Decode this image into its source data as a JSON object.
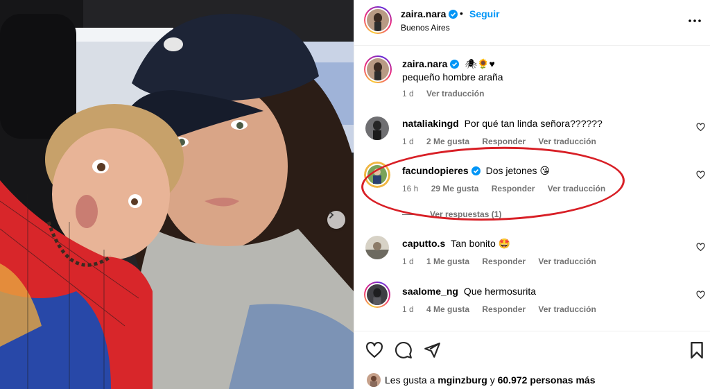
{
  "post": {
    "username": "zaira.nara",
    "separator": "•",
    "follow_label": "Seguir",
    "location": "Buenos Aires"
  },
  "caption": {
    "username": "zaira.nara",
    "emojis": "🕷🌻♥",
    "text": "pequeño hombre araña",
    "time": "1 d",
    "translate": "Ver traducción"
  },
  "comments": [
    {
      "username": "nataliakingd",
      "text": "Por qué tan linda señora??????",
      "time": "1 d",
      "likes": "2 Me gusta",
      "reply": "Responder",
      "translate": "Ver traducción"
    },
    {
      "username": "facundopieres",
      "verified": true,
      "text": "Dos jetones 😘",
      "time": "16 h",
      "likes": "29 Me gusta",
      "reply": "Responder",
      "translate": "Ver traducción",
      "view_replies": "Ver respuestas (1)"
    },
    {
      "username": "caputto.s",
      "text": "Tan bonito 🤩",
      "time": "1 d",
      "likes": "1 Me gusta",
      "reply": "Responder",
      "translate": "Ver traducción"
    },
    {
      "username": "saalome_ng",
      "text": "Que hermosurita",
      "time": "1 d",
      "likes": "4 Me gusta",
      "reply": "Responder",
      "translate": "Ver traducción"
    }
  ],
  "likes_summary": {
    "prefix": "Les gusta a",
    "user": "mginzburg",
    "connector": "y",
    "others": "60.972 personas más"
  },
  "icons": {
    "verified": "verified-badge-icon",
    "more": "more-options-icon",
    "heart": "heart-icon",
    "comment": "comment-bubble-icon",
    "share": "paper-plane-icon",
    "save": "bookmark-icon",
    "next": "chevron-right-icon"
  },
  "colors": {
    "link_blue": "#0095f6",
    "meta_gray": "#737373",
    "highlight_red": "#d81f26"
  }
}
